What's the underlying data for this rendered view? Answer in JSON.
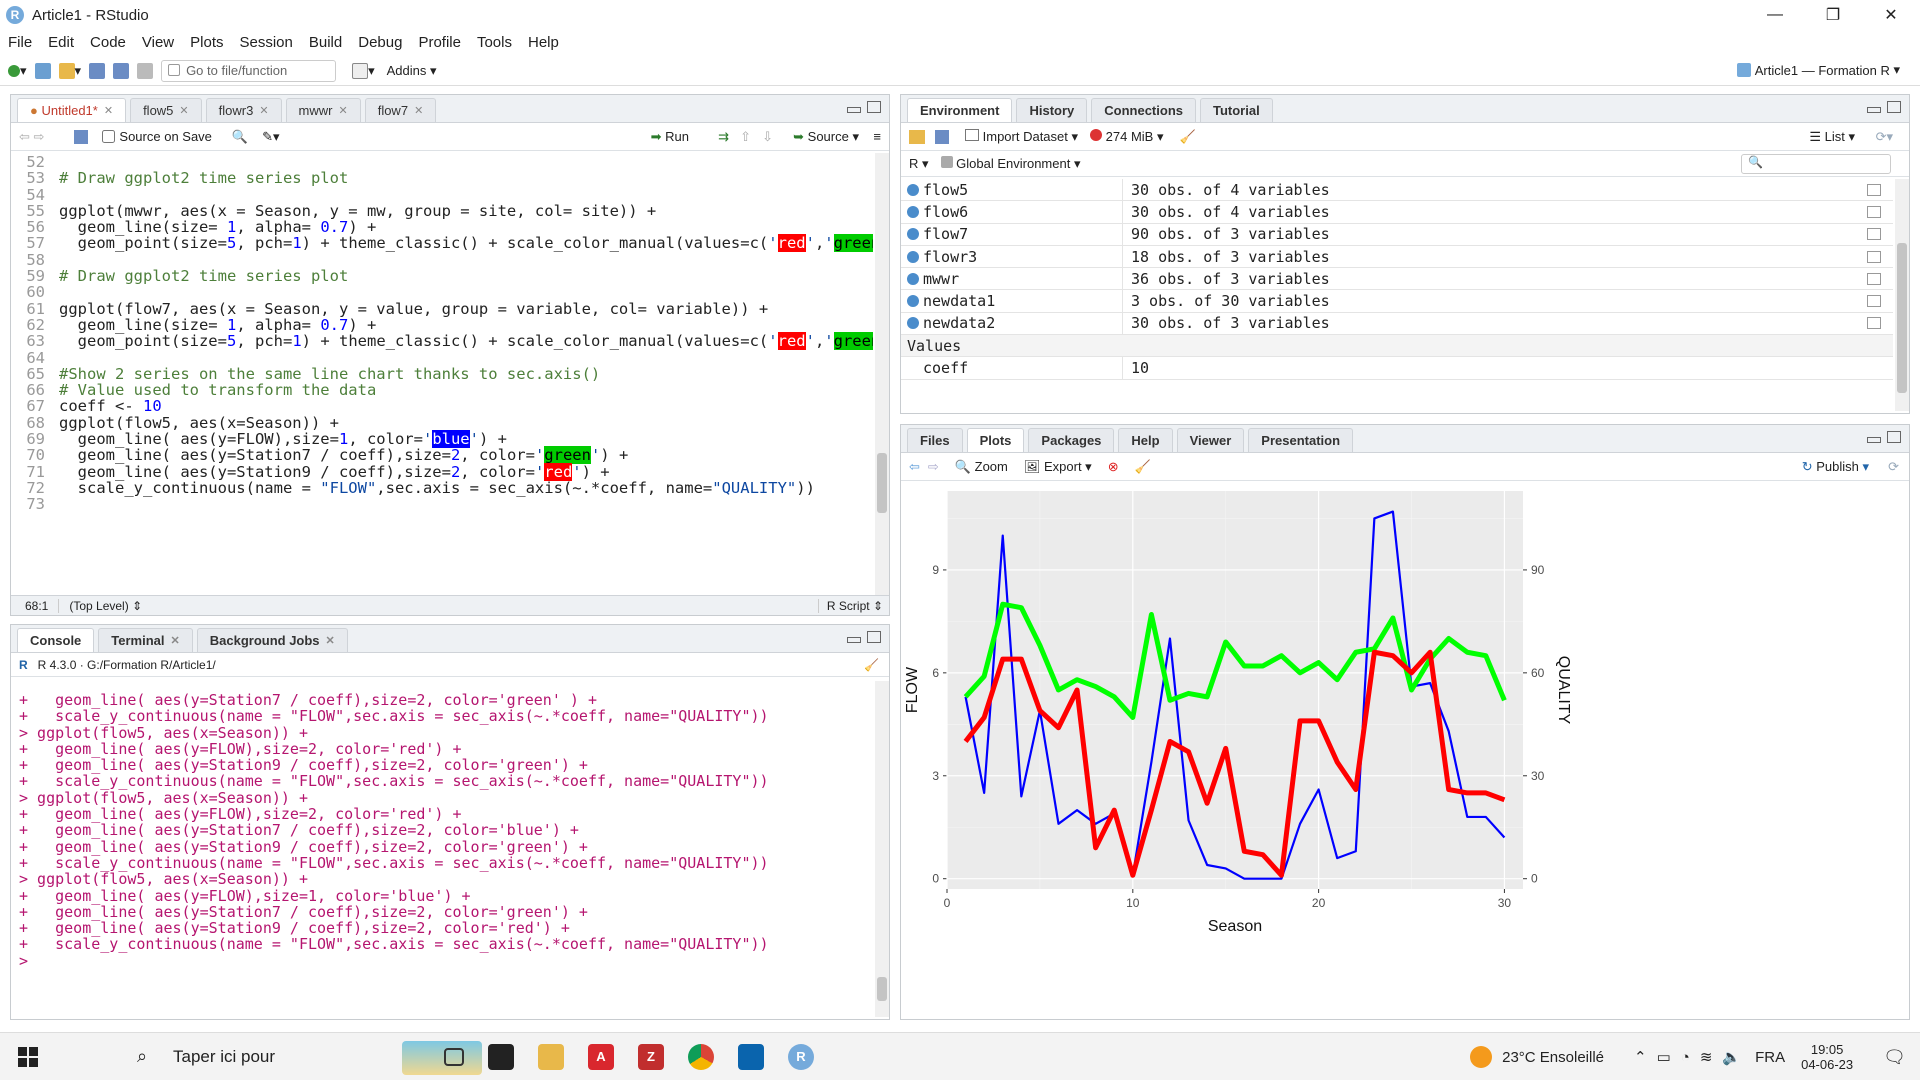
{
  "window": {
    "title": "Article1 - RStudio",
    "minimize": "—",
    "maximize": "❐",
    "close": "✕"
  },
  "menu": [
    "File",
    "Edit",
    "Code",
    "View",
    "Plots",
    "Session",
    "Build",
    "Debug",
    "Profile",
    "Tools",
    "Help"
  ],
  "toolbar": {
    "goto_placeholder": "Go to file/function",
    "addins": "Addins",
    "project": "Article1 — Formation R"
  },
  "editor": {
    "tabs": [
      "Untitled1*",
      "flow5",
      "flowr3",
      "mwwr",
      "flow7"
    ],
    "source_on_save": "Source on Save",
    "run": "Run",
    "source": "Source",
    "position": "68:1",
    "scope": "(Top Level)",
    "filetype": "R Script"
  },
  "console": {
    "tabs": [
      "Console",
      "Terminal",
      "Background Jobs"
    ],
    "header": "R 4.3.0 · G:/Formation R/Article1/",
    "lines": [
      "+   geom_line( aes(y=Station7 / coeff),size=2, color='green' ) +",
      "+   scale_y_continuous(name = \"FLOW\",sec.axis = sec_axis(~.*coeff, name=\"QUALITY\"))",
      "> ggplot(flow5, aes(x=Season)) +",
      "+   geom_line( aes(y=FLOW),size=2, color='red') +",
      "+   geom_line( aes(y=Station9 / coeff),size=2, color='green') +",
      "+   scale_y_continuous(name = \"FLOW\",sec.axis = sec_axis(~.*coeff, name=\"QUALITY\"))",
      "> ggplot(flow5, aes(x=Season)) +",
      "+   geom_line( aes(y=FLOW),size=2, color='red') +",
      "+   geom_line( aes(y=Station7 / coeff),size=2, color='blue') +",
      "+   geom_line( aes(y=Station9 / coeff),size=2, color='green') +",
      "+   scale_y_continuous(name = \"FLOW\",sec.axis = sec_axis(~.*coeff, name=\"QUALITY\"))",
      "> ggplot(flow5, aes(x=Season)) +",
      "+   geom_line( aes(y=FLOW),size=1, color='blue') +",
      "+   geom_line( aes(y=Station7 / coeff),size=2, color='green') +",
      "+   geom_line( aes(y=Station9 / coeff),size=2, color='red') +",
      "+   scale_y_continuous(name = \"FLOW\",sec.axis = sec_axis(~.*coeff, name=\"QUALITY\"))",
      "> "
    ]
  },
  "environment": {
    "tabs": [
      "Environment",
      "History",
      "Connections",
      "Tutorial"
    ],
    "import": "Import Dataset",
    "memory": "274 MiB",
    "list": "List",
    "r": "R",
    "global": "Global Environment",
    "rows": [
      {
        "name": "flow5",
        "value": "30 obs. of 4 variables"
      },
      {
        "name": "flow6",
        "value": "30 obs. of 4 variables"
      },
      {
        "name": "flow7",
        "value": "90 obs. of 3 variables"
      },
      {
        "name": "flowr3",
        "value": "18 obs. of 3 variables"
      },
      {
        "name": "mwwr",
        "value": "36 obs. of 3 variables"
      },
      {
        "name": "newdata1",
        "value": "3 obs. of 30 variables"
      },
      {
        "name": "newdata2",
        "value": "30 obs. of 3 variables"
      }
    ],
    "values_header": "Values",
    "values": [
      {
        "name": "coeff",
        "value": "10"
      }
    ]
  },
  "plots": {
    "tabs": [
      "Files",
      "Plots",
      "Packages",
      "Help",
      "Viewer",
      "Presentation"
    ],
    "zoom": "Zoom",
    "export": "Export",
    "publish": "Publish"
  },
  "chart_data": {
    "type": "line",
    "xlabel": "Season",
    "ylabel": "FLOW",
    "y2label": "QUALITY",
    "xlim": [
      0,
      31
    ],
    "ylim": [
      -0.3,
      11.3
    ],
    "xticks": [
      0,
      10,
      20,
      30
    ],
    "yticks": [
      0,
      3,
      6,
      9
    ],
    "y2ticks": [
      0,
      30,
      60,
      90
    ],
    "x": [
      1,
      2,
      3,
      4,
      5,
      6,
      7,
      8,
      9,
      10,
      11,
      12,
      13,
      14,
      15,
      16,
      17,
      18,
      19,
      20,
      21,
      22,
      23,
      24,
      25,
      26,
      27,
      28,
      29,
      30
    ],
    "series": [
      {
        "color": "#0000ff",
        "width": 1,
        "values": [
          5.3,
          2.5,
          10.0,
          2.4,
          4.9,
          1.6,
          2.0,
          1.6,
          1.9,
          0.1,
          3.4,
          7.0,
          1.7,
          0.4,
          0.3,
          0.0,
          0.0,
          0.0,
          1.6,
          2.6,
          0.6,
          0.8,
          10.5,
          10.7,
          5.6,
          5.7,
          4.3,
          1.8,
          1.8,
          1.2
        ]
      },
      {
        "color": "#00ff00",
        "width": 2,
        "values": [
          5.3,
          5.9,
          8.0,
          7.9,
          6.8,
          5.5,
          5.8,
          5.6,
          5.3,
          4.7,
          7.7,
          5.2,
          5.4,
          5.3,
          6.9,
          6.2,
          6.2,
          6.5,
          6.0,
          6.3,
          5.8,
          6.6,
          6.7,
          7.6,
          5.5,
          6.4,
          7.0,
          6.6,
          6.5,
          5.2
        ]
      },
      {
        "color": "#ff0000",
        "width": 2,
        "values": [
          4.0,
          4.7,
          6.4,
          6.4,
          4.9,
          4.4,
          5.5,
          0.9,
          2.0,
          0.1,
          2.0,
          4.0,
          3.7,
          2.2,
          3.8,
          0.8,
          0.7,
          0.1,
          4.6,
          4.6,
          3.4,
          2.6,
          6.6,
          6.5,
          6.0,
          6.6,
          2.6,
          2.5,
          2.5,
          2.3
        ]
      }
    ]
  },
  "taskbar": {
    "search": "Taper ici pour",
    "weather": "23°C  Ensoleillé",
    "lang": "FRA",
    "time": "19:05",
    "date": "04-06-23"
  }
}
